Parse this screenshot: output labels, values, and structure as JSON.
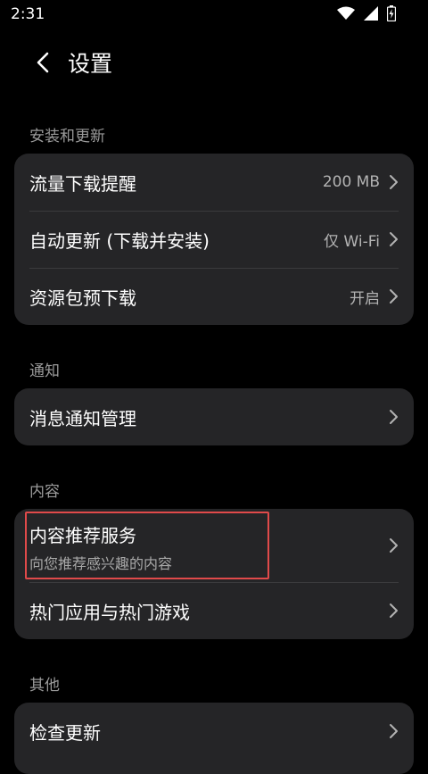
{
  "status_bar": {
    "time": "2:31",
    "icons": [
      "wifi-icon",
      "signal-icon",
      "battery-icon"
    ]
  },
  "header": {
    "title": "设置"
  },
  "sections": {
    "install_update": {
      "title": "安装和更新",
      "items": [
        {
          "label": "流量下载提醒",
          "value": "200 MB"
        },
        {
          "label": "自动更新 (下载并安装)",
          "value": "仅 Wi-Fi"
        },
        {
          "label": "资源包预下载",
          "value": "开启"
        }
      ]
    },
    "notification": {
      "title": "通知",
      "items": [
        {
          "label": "消息通知管理"
        }
      ]
    },
    "content": {
      "title": "内容",
      "items": [
        {
          "label": "内容推荐服务",
          "sub": "向您推荐感兴趣的内容"
        },
        {
          "label": "热门应用与热门游戏"
        }
      ]
    },
    "other": {
      "title": "其他",
      "items": [
        {
          "label": "检查更新"
        }
      ]
    }
  },
  "colors": {
    "background": "#000000",
    "card": "#252527",
    "highlight_border": "#e04a4a",
    "secondary_text": "#9a9a9a"
  }
}
